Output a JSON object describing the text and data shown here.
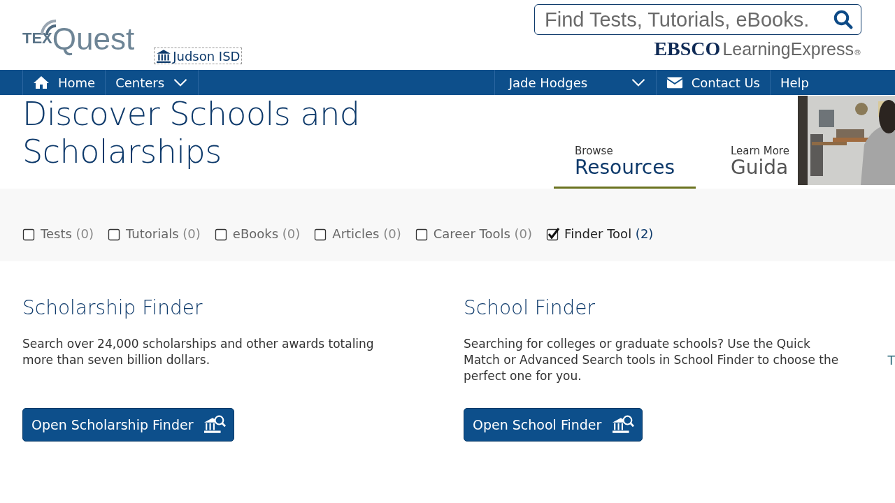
{
  "logo": {
    "prefix": "TEX",
    "name": "Quest"
  },
  "institution": "Judson ISD",
  "search": {
    "placeholder": "Find Tests, Tutorials, eBooks."
  },
  "partner": {
    "brand": "EBSCO",
    "product": "LearningExpress",
    "mark": "®"
  },
  "nav": [
    {
      "kind": "home",
      "label": "Home"
    },
    {
      "kind": "menu",
      "label": "Centers"
    },
    {
      "kind": "spacer"
    },
    {
      "kind": "menu",
      "label": "Jade Hodges"
    },
    {
      "kind": "mail",
      "label": "Contact Us"
    },
    {
      "kind": "plain",
      "label": "Help"
    }
  ],
  "page_title": "Discover Schools and Scholarships",
  "section_tabs": [
    {
      "kicker": "Browse",
      "label": "Resources",
      "selected": true
    },
    {
      "kicker": "Learn More",
      "label": "Guida",
      "selected": false
    }
  ],
  "filters": [
    {
      "label": "Tests",
      "count": "(0)",
      "checked": false
    },
    {
      "label": "Tutorials",
      "count": "(0)",
      "checked": false
    },
    {
      "label": "eBooks",
      "count": "(0)",
      "checked": false
    },
    {
      "label": "Articles",
      "count": "(0)",
      "checked": false
    },
    {
      "label": "Career Tools",
      "count": "(0)",
      "checked": false
    },
    {
      "label": "Finder Tool",
      "count": "(2)",
      "checked": true
    }
  ],
  "cards": [
    {
      "title": "Scholarship Finder",
      "text": "Search over 24,000 scholarships and other awards totaling more than seven billion dollars.",
      "button": "Open Scholarship Finder"
    },
    {
      "title": "School Finder",
      "text": "Searching for colleges or graduate schools? Use the Quick Match or Advanced Search tools in School Finder to choose the perfect one for you.",
      "button": "Open School Finder"
    }
  ],
  "edge_text": "T"
}
